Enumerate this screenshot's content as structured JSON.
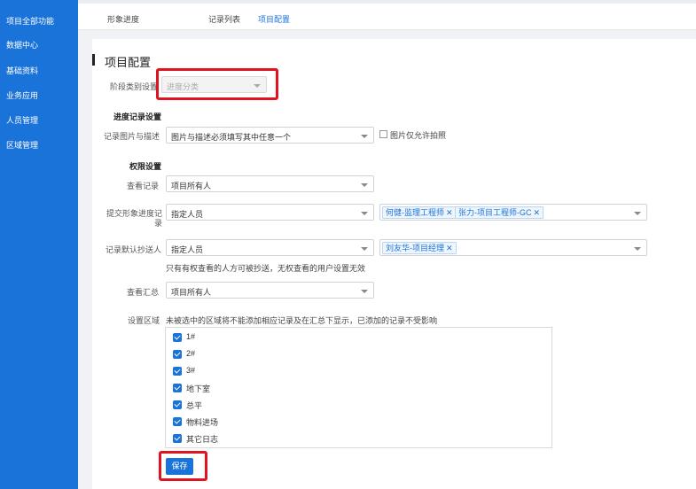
{
  "sidebar": {
    "items": [
      {
        "label": "项目全部功能"
      },
      {
        "label": "数据中心"
      },
      {
        "label": "基础资料"
      },
      {
        "label": "业务应用"
      },
      {
        "label": "人员管理"
      },
      {
        "label": "区域管理"
      }
    ]
  },
  "tabs": [
    {
      "label": "形象进度",
      "active": false
    },
    {
      "label": "记录列表",
      "active": false
    },
    {
      "label": "项目配置",
      "active": true
    }
  ],
  "page": {
    "title": "项目配置"
  },
  "stage_category": {
    "label": "阶段类别设置",
    "value": "进度分类",
    "disabled": true
  },
  "record_settings": {
    "title": "进度记录设置",
    "image_desc": {
      "label": "记录图片与描述",
      "value": "图片与描述必须填写其中任意一个"
    },
    "photo_only": {
      "label": "图片仅允许拍照",
      "checked": false
    }
  },
  "permissions": {
    "title": "权限设置",
    "view_records": {
      "label": "查看记录",
      "value": "项目所有人"
    },
    "submit_progress": {
      "label_line1": "提交形象进度记",
      "label_line2": "录",
      "value": "指定人员",
      "tags": [
        "何健-监理工程师",
        "张力-项目工程师-GC"
      ]
    },
    "default_cc": {
      "label": "记录默认抄送人",
      "value": "指定人员",
      "tags": [
        "刘友华-项目经理"
      ],
      "hint": "只有有权查看的人方可被抄送，无权查看的用户设置无效"
    },
    "view_summary": {
      "label": "查看汇总",
      "value": "项目所有人"
    },
    "region": {
      "label": "设置区域",
      "hint": "未被选中的区域将不能添加相应记录及在汇总下显示，已添加的记录不受影响",
      "items": [
        {
          "label": "1#",
          "checked": true
        },
        {
          "label": "2#",
          "checked": true
        },
        {
          "label": "3#",
          "checked": true
        },
        {
          "label": "地下室",
          "checked": true
        },
        {
          "label": "总平",
          "checked": true
        },
        {
          "label": "物料进场",
          "checked": true
        },
        {
          "label": "其它日志",
          "checked": true
        }
      ]
    }
  },
  "save_label": "保存",
  "colors": {
    "primary": "#1a73d9",
    "highlight": "#e0141e"
  }
}
